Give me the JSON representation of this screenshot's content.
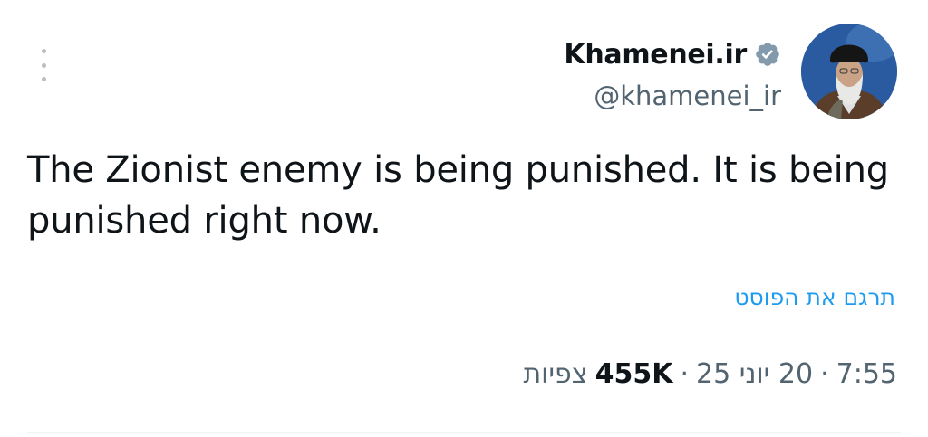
{
  "author": {
    "display_name": "Khamenei.ir",
    "handle": "@khamenei_ir",
    "verified": true,
    "verified_color": "#829aab"
  },
  "tweet": {
    "text": "The Zionist enemy is being punished. It is being punished right now."
  },
  "translate": {
    "label": "תרגם את הפוסט",
    "color": "#1d9bf0"
  },
  "meta": {
    "time": "7:55",
    "date": "20 יוני 25",
    "views_count": "455K",
    "views_label": "צפיות",
    "separator": "·"
  },
  "icons": {
    "more": "more-vertical-icon",
    "verified": "verified-badge-icon"
  }
}
